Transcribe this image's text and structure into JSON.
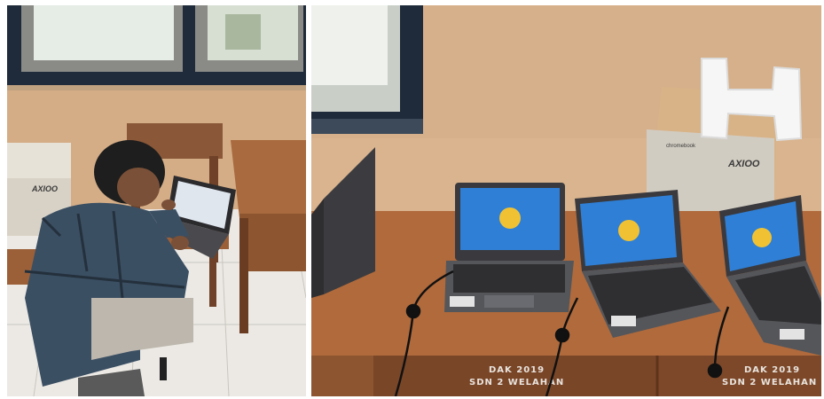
{
  "photo_left": {
    "box_brand": "AXIOO"
  },
  "photo_right": {
    "box_brand": "AXIOO",
    "box_subbrand": "chromebook",
    "desk_label_line1": "DAK 2019",
    "desk_label_line2": "SDN 2 WELAHAN",
    "desk_label2_line1": "DAK 2019",
    "desk_label2_line2": "SDN 2 WELAHAN"
  },
  "colors": {
    "wall": "#d9b48e",
    "desk": "#b06a3c",
    "screen": "#2f7fd6",
    "shirt": "#3b4f63",
    "window_frame": "#1f2b3a"
  }
}
